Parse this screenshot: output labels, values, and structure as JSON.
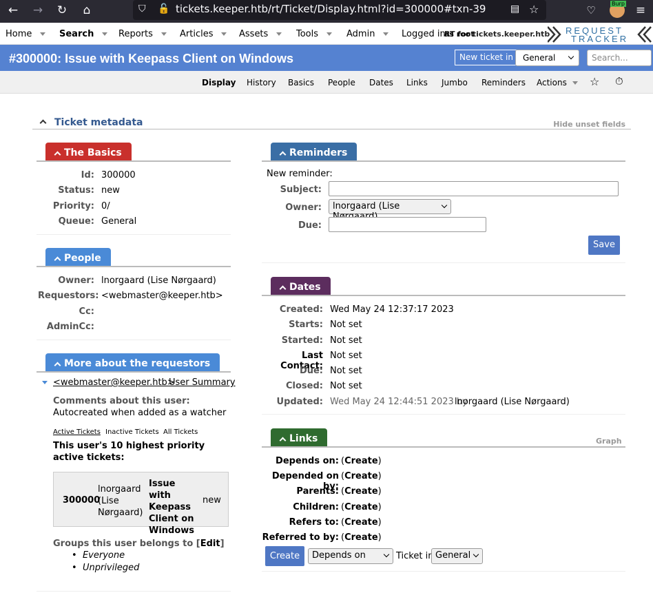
{
  "browser": {
    "url": "tickets.keeper.htb/rt/Ticket/Display.html?id=300000#txn-39",
    "ext_badge": "Burp"
  },
  "menu": {
    "items": [
      "Home",
      "Search",
      "Reports",
      "Articles",
      "Assets",
      "Tools",
      "Admin"
    ],
    "logged_in_prefix": "Logged in",
    "logged_in_overlay": "as root",
    "host": "RT for tickets.keeper.htb",
    "logo_line1": "REQUEST",
    "logo_line2": "TRACKER"
  },
  "title": {
    "text": "#300000: Issue with Keepass Client on Windows",
    "new_ticket": "New ticket in",
    "queue_select": "General",
    "search_placeholder": "Search..."
  },
  "subnav": [
    "Display",
    "History",
    "Basics",
    "People",
    "Dates",
    "Links",
    "Jumbo",
    "Reminders",
    "Actions"
  ],
  "metadata": {
    "title": "Ticket metadata",
    "hide": "Hide unset fields"
  },
  "basics": {
    "title": "The Basics",
    "rows": [
      {
        "label": "Id:",
        "value": "300000"
      },
      {
        "label": "Status:",
        "value": "new"
      },
      {
        "label": "Priority:",
        "value": "0/"
      },
      {
        "label": "Queue:",
        "value": "General"
      }
    ]
  },
  "people": {
    "title": "People",
    "rows": [
      {
        "label": "Owner:",
        "value": "lnorgaard (Lise Nørgaard)"
      },
      {
        "label": "Requestors:",
        "value": "<webmaster@keeper.htb>"
      },
      {
        "label": "Cc:",
        "value": ""
      },
      {
        "label": "AdminCc:",
        "value": ""
      }
    ]
  },
  "requestors": {
    "title": "More about the requestors",
    "email": "<webmaster@keeper.htb>",
    "user_summary": "User Summary",
    "comments_label": "Comments about this user:",
    "comments": "Autocreated when added as a watcher",
    "tabs": [
      "Active Tickets",
      "Inactive Tickets",
      "All Tickets"
    ],
    "top_label": "This user's 10 highest priority active tickets:",
    "ticket": {
      "id": "300000",
      "owner": "lnorgaard (Lise Nørgaard)",
      "subject": "Issue with Keepass Client on Windows",
      "status": "new"
    },
    "groups_label": "Groups this user belongs to [",
    "groups_edit": "Edit",
    "groups_close": "]",
    "groups": [
      "Everyone",
      "Unprivileged"
    ]
  },
  "reminders": {
    "title": "Reminders",
    "new_label": "New reminder:",
    "subject_label": "Subject:",
    "owner_label": "Owner:",
    "owner_value": "lnorgaard (Lise Nørgaard)",
    "due_label": "Due:",
    "save": "Save"
  },
  "dates": {
    "title": "Dates",
    "rows": [
      {
        "label": "Created:",
        "value": "Wed May 24 12:37:17 2023"
      },
      {
        "label": "Starts:",
        "value": "Not set"
      },
      {
        "label": "Started:",
        "value": "Not set"
      },
      {
        "label": "Last Contact:",
        "value": "Not set"
      },
      {
        "label": "Due:",
        "value": "Not set"
      },
      {
        "label": "Closed:",
        "value": "Not set"
      }
    ],
    "updated_label": "Updated:",
    "updated_value": "Wed May 24 12:44:51 2023 by",
    "updated_by": "lnorgaard (Lise Nørgaard)"
  },
  "links": {
    "title": "Links",
    "graph": "Graph",
    "rows": [
      "Depends on:",
      "Depended on by:",
      "Parents:",
      "Children:",
      "Refers to:",
      "Referred to by:"
    ],
    "create": "Create",
    "create_button": "Create",
    "type_select": "Depends on",
    "ticket_in": "Ticket in",
    "queue_select": "General"
  },
  "colors": {
    "titlebar": "#5582d1",
    "basics": "#c9302c",
    "people": "#4a8ad7",
    "reminders": "#3a6ea5",
    "dates": "#5c2d5e",
    "links": "#2f6b2f"
  }
}
